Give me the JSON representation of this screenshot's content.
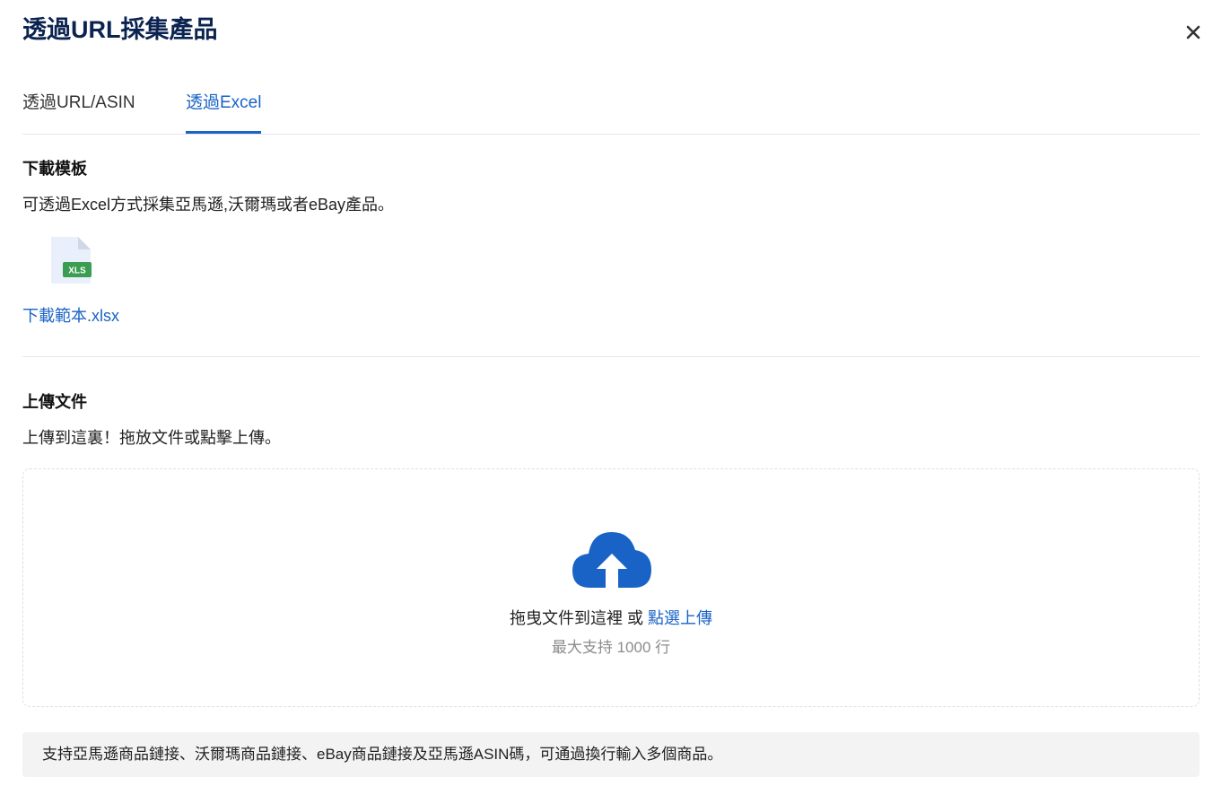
{
  "dialog": {
    "title": "透過URL採集產品"
  },
  "tabs": [
    {
      "label": "透過URL/ASIN",
      "active": false
    },
    {
      "label": "透過Excel",
      "active": true
    }
  ],
  "download": {
    "title": "下載模板",
    "description": "可透過Excel方式採集亞馬遜,沃爾瑪或者eBay產品。",
    "file_badge": "XLS",
    "link_label": "下載範本.xlsx"
  },
  "upload": {
    "title": "上傳文件",
    "description": "上傳到這裏！拖放文件或點擊上傳。",
    "drop_text": "拖曳文件到這裡 或 ",
    "drop_link": "點選上傳",
    "limit_text": "最大支持 1000 行"
  },
  "note": "支持亞馬遜商品鏈接、沃爾瑪商品鏈接、eBay商品鏈接及亞馬遜ASIN碼，可通過換行輸入多個商品。",
  "icons": {
    "close": "close-icon",
    "file": "xls-file-icon",
    "upload": "cloud-upload-icon"
  },
  "colors": {
    "accent": "#1a63c6",
    "title": "#0b2350",
    "xls_badge": "#3a9d52"
  }
}
